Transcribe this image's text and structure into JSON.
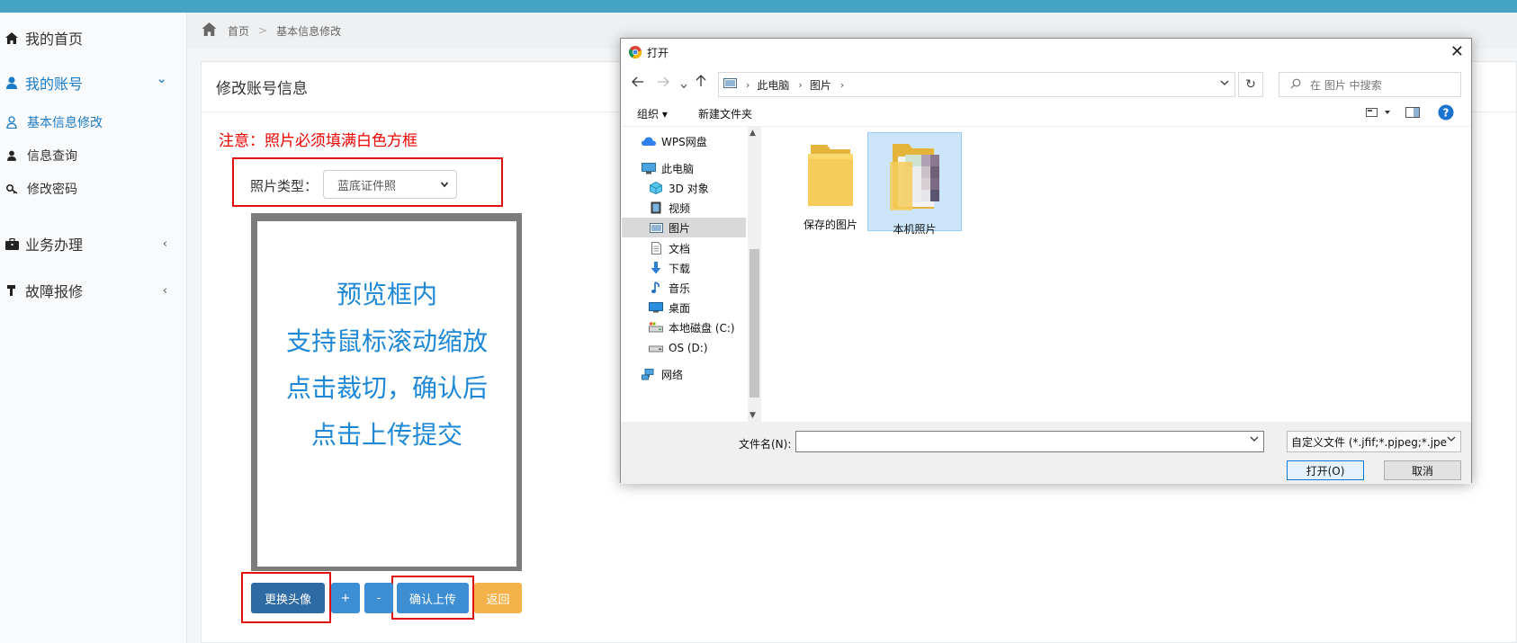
{
  "sidebar": {
    "items": [
      {
        "label": "我的首页",
        "icon": "home-icon"
      },
      {
        "label": "我的账号",
        "icon": "user-icon",
        "arrow": "⌄"
      },
      {
        "label": "业务办理",
        "icon": "briefcase-icon",
        "arrow": "‹"
      },
      {
        "label": "故障报修",
        "icon": "wrench-icon",
        "arrow": "‹"
      }
    ],
    "subitems": [
      {
        "label": "基本信息修改",
        "icon": "user-outline-icon"
      },
      {
        "label": "信息查询",
        "icon": "user-icon"
      },
      {
        "label": "修改密码",
        "icon": "key-icon"
      }
    ]
  },
  "breadcrumb": {
    "home": "首页",
    "sep": ">",
    "current": "基本信息修改"
  },
  "panel": {
    "title": "修改账号信息"
  },
  "notice": "注意：照片必须填满白色方框",
  "photo_type": {
    "label": "照片类型：",
    "value": "蓝底证件照"
  },
  "preview": {
    "line1": "预览框内",
    "line2": "支持鼠标滚动缩放",
    "line3": "点击裁切，确认后",
    "line4": "点击上传提交"
  },
  "buttons": {
    "change": "更换头像",
    "zoom_in": "+",
    "zoom_out": "-",
    "confirm": "确认上传",
    "back": "返回"
  },
  "dialog": {
    "title": "打开",
    "close": "✕",
    "address": {
      "root": "此电脑",
      "folder": "图片"
    },
    "search_placeholder": "在 图片 中搜索",
    "toolbar": {
      "organize": "组织 ▾",
      "new_folder": "新建文件夹",
      "help": "?"
    },
    "tree": [
      {
        "label": "WPS网盘",
        "icon": "cloud-icon"
      },
      {
        "label": "此电脑",
        "icon": "computer-icon"
      },
      {
        "label": "3D 对象",
        "icon": "cube-icon"
      },
      {
        "label": "视频",
        "icon": "video-icon"
      },
      {
        "label": "图片",
        "icon": "pictures-icon"
      },
      {
        "label": "文档",
        "icon": "document-icon"
      },
      {
        "label": "下载",
        "icon": "download-icon"
      },
      {
        "label": "音乐",
        "icon": "music-icon"
      },
      {
        "label": "桌面",
        "icon": "desktop-icon"
      },
      {
        "label": "本地磁盘 (C:)",
        "icon": "drive-icon"
      },
      {
        "label": "OS (D:)",
        "icon": "drive-icon"
      },
      {
        "label": "网络",
        "icon": "network-icon"
      }
    ],
    "files": [
      {
        "name": "保存的图片"
      },
      {
        "name": "本机照片"
      }
    ],
    "filename_label": "文件名(N):",
    "filename_value": "",
    "filter": "自定义文件 (*.jfif;*.pjpeg;*.jpe",
    "open": "打开(O)",
    "cancel": "取消"
  },
  "colors": {
    "accent": "#45a3c4",
    "link": "#1b7bc7",
    "notice": "#ee0000",
    "preview_text": "#1e88d6",
    "btn_dark": "#2e6aa3",
    "btn_blue": "#3d8ed3",
    "btn_orange": "#f5b24a"
  }
}
